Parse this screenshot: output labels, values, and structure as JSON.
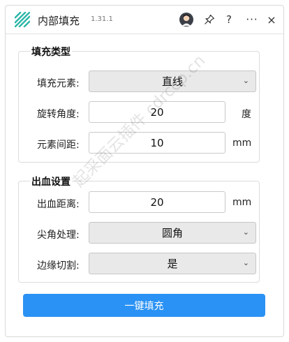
{
  "app": {
    "title": "内部填充",
    "version": "1.31.1",
    "help_label": "?",
    "more_label": "···",
    "close_label": "×"
  },
  "fill_type": {
    "title": "填充类型",
    "element_label": "填充元素:",
    "element_value": "直线",
    "angle_label": "旋转角度:",
    "angle_value": "20",
    "angle_unit": "度",
    "spacing_label": "元素间距:",
    "spacing_value": "10",
    "spacing_unit": "mm"
  },
  "bleed": {
    "title": "出血设置",
    "distance_label": "出血距离:",
    "distance_value": "20",
    "distance_unit": "mm",
    "corner_label": "尖角处理:",
    "corner_value": "圆角",
    "cut_label": "边缘切割:",
    "cut_value": "是"
  },
  "action": {
    "fill_label": "一键填充"
  },
  "watermark": "起采面云插件 cdrccp.cn",
  "colors": {
    "primary": "#2a92f4"
  },
  "icons": [
    "logo-icon",
    "avatar-icon",
    "pin-icon",
    "help-icon",
    "more-icon",
    "close-icon",
    "chevron-down-icon"
  ]
}
